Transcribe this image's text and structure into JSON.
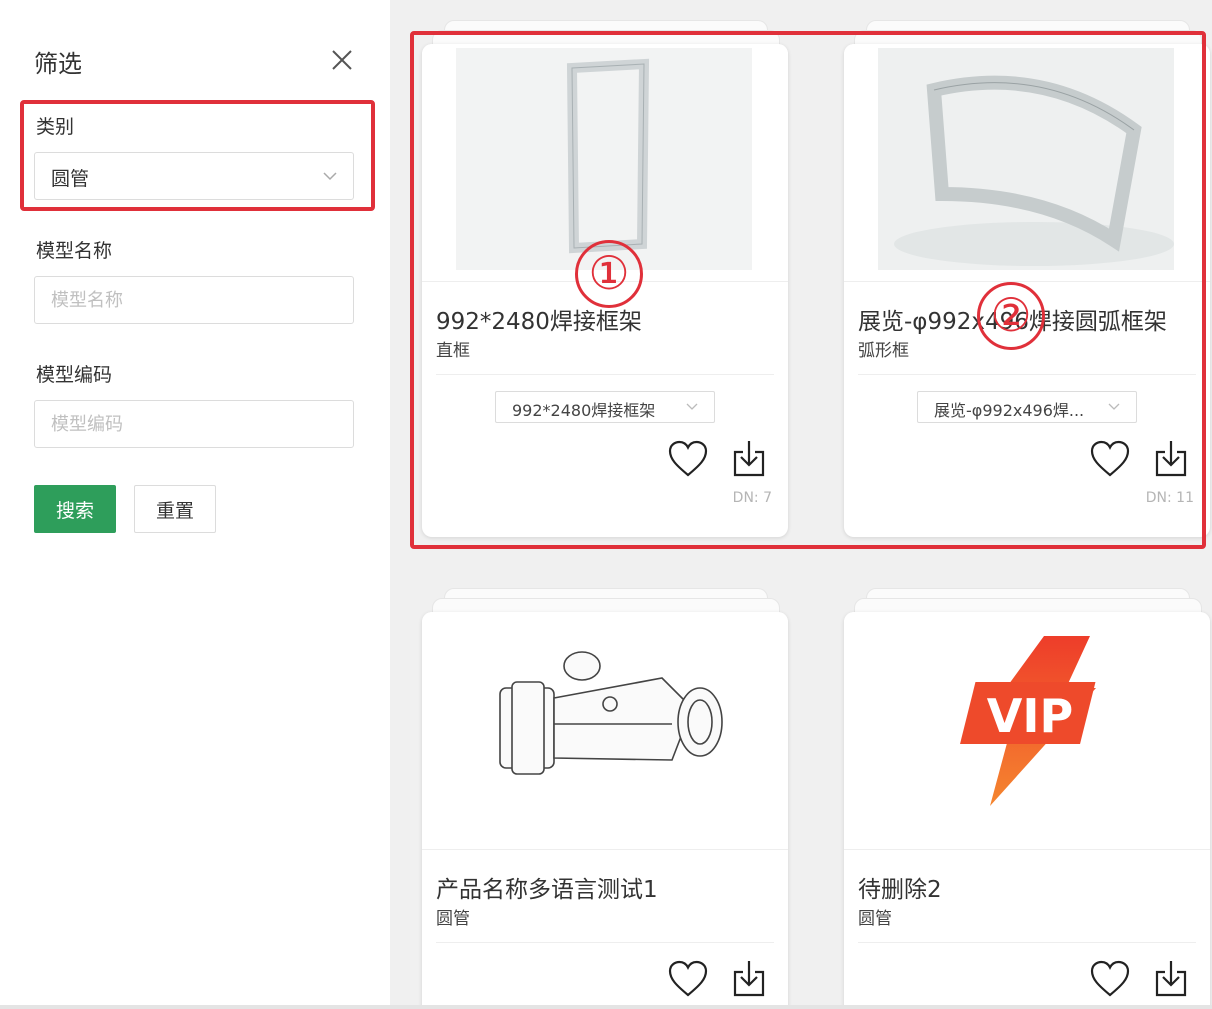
{
  "filter": {
    "title": "筛选",
    "category_label": "类别",
    "category_value": "圆管",
    "model_name_label": "模型名称",
    "model_name_placeholder": "模型名称",
    "model_code_label": "模型编码",
    "model_code_placeholder": "模型编码",
    "search_button": "搜索",
    "reset_button": "重置"
  },
  "annotations": {
    "marker_1": "①",
    "marker_2": "②",
    "highlight_color": "#e0303a"
  },
  "cards": [
    {
      "name": "992*2480焊接框架",
      "category": "直框",
      "spec": "992*2480焊接框架",
      "dn": "DN: 7",
      "image": "rect-frame"
    },
    {
      "name": "展览-φ992x496焊接圆弧框架",
      "category": "弧形框",
      "spec": "展览-φ992x496焊...",
      "dn": "DN: 11",
      "image": "arc-frame"
    },
    {
      "name": "产品名称多语言测试1",
      "category": "圆管",
      "image": "pipe-fitting"
    },
    {
      "name": "待删除2",
      "category": "圆管",
      "image": "vip-badge",
      "vip_text": "VIP"
    }
  ],
  "icons": {
    "favorite": "heart-icon",
    "download": "download-icon",
    "close": "close-icon",
    "caret": "chevron-down-icon"
  },
  "colors": {
    "primary_green": "#2e9e5b",
    "vip_orange": "#f0552a"
  }
}
